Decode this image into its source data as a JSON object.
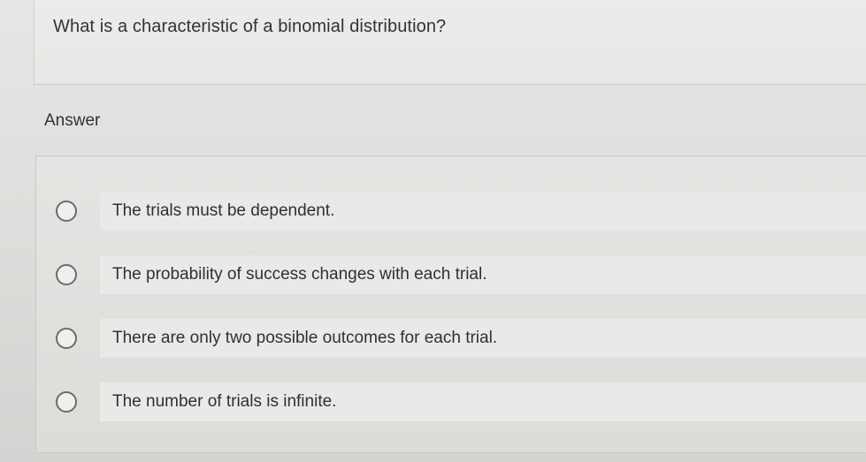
{
  "question": {
    "text": "What is a characteristic of a binomial distribution?"
  },
  "answer_section": {
    "label": "Answer"
  },
  "options": [
    {
      "text": "The trials must be dependent.",
      "selected": false
    },
    {
      "text": "The probability of success changes with each trial.",
      "selected": false
    },
    {
      "text": "There are only two possible outcomes for each trial.",
      "selected": false
    },
    {
      "text": "The number of trials is infinite.",
      "selected": false
    }
  ]
}
